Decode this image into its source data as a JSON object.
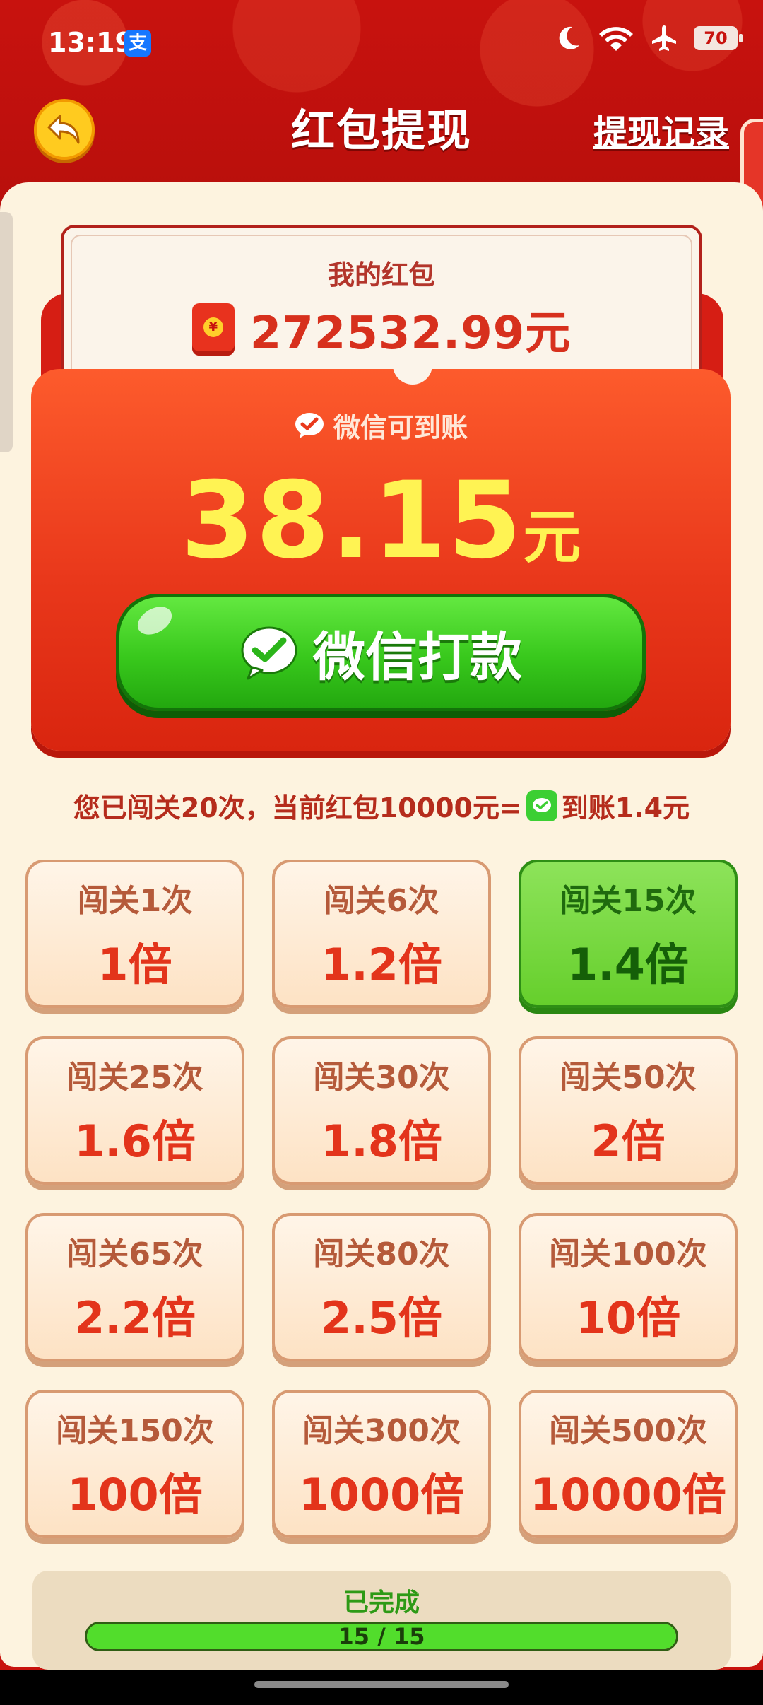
{
  "status_bar": {
    "time": "13:19",
    "alipay_icon": "支",
    "battery": "70",
    "icons": [
      "moon-icon",
      "wifi-icon",
      "airplane-icon",
      "battery-icon"
    ]
  },
  "header": {
    "title": "红包提现",
    "records_link": "提现记录"
  },
  "balance": {
    "label": "我的红包",
    "coin_symbol": "¥",
    "amount": "272532.99元"
  },
  "withdraw": {
    "label": "微信可到账",
    "amount": "38.15",
    "unit": "元",
    "button_label": "微信打款"
  },
  "info": {
    "prefix": "您已闯关20次，当前红包10000元=",
    "suffix": "到账1.4元"
  },
  "tiers": [
    {
      "condition": "闯关1次",
      "multiplier": "1倍",
      "active": false
    },
    {
      "condition": "闯关6次",
      "multiplier": "1.2倍",
      "active": false
    },
    {
      "condition": "闯关15次",
      "multiplier": "1.4倍",
      "active": true
    },
    {
      "condition": "闯关25次",
      "multiplier": "1.6倍",
      "active": false
    },
    {
      "condition": "闯关30次",
      "multiplier": "1.8倍",
      "active": false
    },
    {
      "condition": "闯关50次",
      "multiplier": "2倍",
      "active": false
    },
    {
      "condition": "闯关65次",
      "multiplier": "2.2倍",
      "active": false
    },
    {
      "condition": "闯关80次",
      "multiplier": "2.5倍",
      "active": false
    },
    {
      "condition": "闯关100次",
      "multiplier": "10倍",
      "active": false
    },
    {
      "condition": "闯关150次",
      "multiplier": "100倍",
      "active": false
    },
    {
      "condition": "闯关300次",
      "multiplier": "1000倍",
      "active": false
    },
    {
      "condition": "闯关500次",
      "multiplier": "10000倍",
      "active": false
    }
  ],
  "progress": {
    "status": "已完成",
    "text": "15 / 15",
    "fraction": 1.0
  },
  "colors": {
    "brand_red": "#c8120e",
    "wechat_green": "#38c81c",
    "amount_yellow": "#fff353",
    "panel_bg": "#fdf3df"
  }
}
